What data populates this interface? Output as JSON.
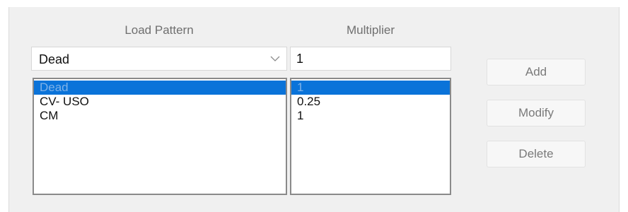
{
  "headers": {
    "load_pattern": "Load Pattern",
    "multiplier": "Multiplier"
  },
  "load_pattern_combo": {
    "selected": "Dead"
  },
  "multiplier_input": {
    "value": "1"
  },
  "rows": [
    {
      "pattern": "Dead",
      "multiplier": "1",
      "selected": true
    },
    {
      "pattern": "CV- USO",
      "multiplier": "0.25",
      "selected": false
    },
    {
      "pattern": "CM",
      "multiplier": "1",
      "selected": false
    }
  ],
  "buttons": {
    "add": "Add",
    "modify": "Modify",
    "delete": "Delete"
  },
  "colors": {
    "selection": "#0a73d9",
    "selection_text": "#7fb2e8",
    "panel_bg": "#f0f0f0"
  },
  "icons": {
    "combo_arrow": "chevron-down-icon"
  }
}
